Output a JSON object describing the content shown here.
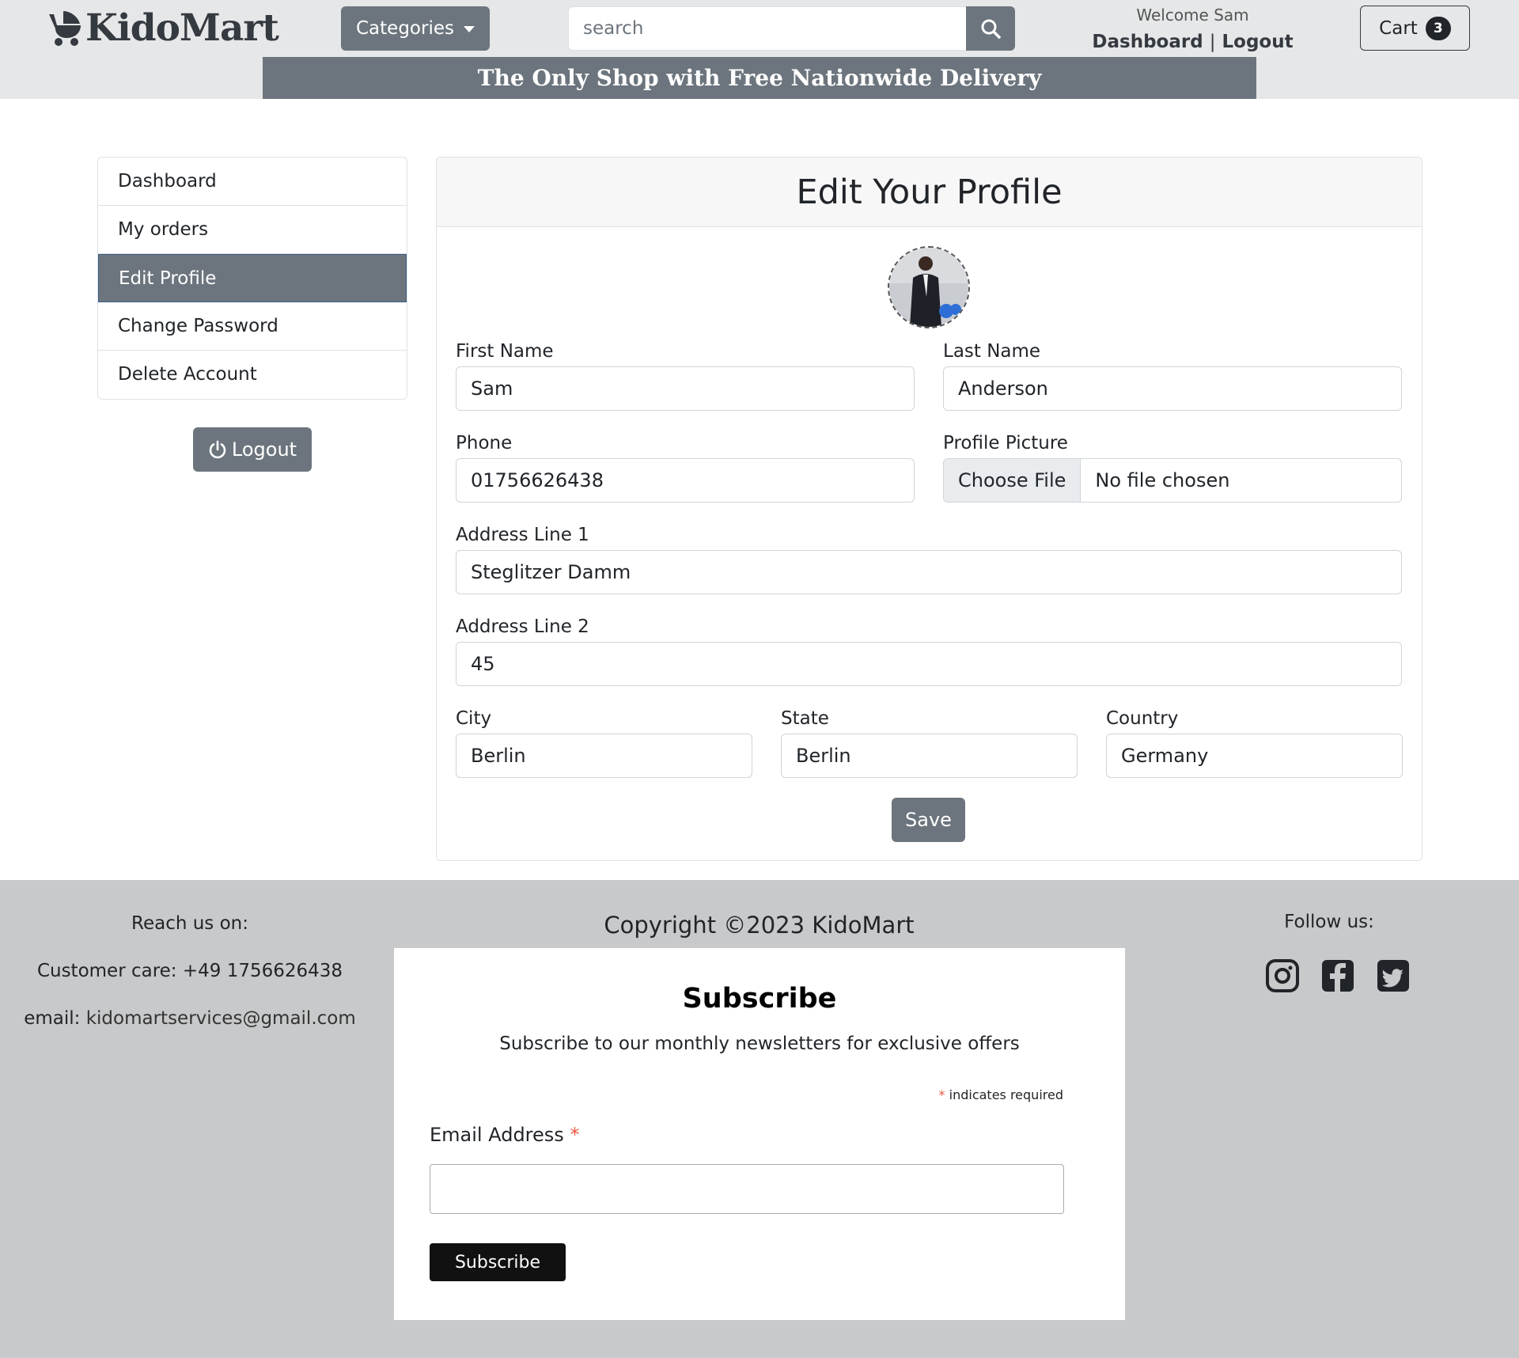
{
  "header": {
    "logo_text": "KidoMart",
    "categories_label": "Categories",
    "search_placeholder": "search",
    "welcome_text": "Welcome Sam",
    "dashboard_link": "Dashboard",
    "separator": "|",
    "logout_link": "Logout",
    "cart_label": "Cart",
    "cart_count": "3",
    "banner": "The Only Shop with Free Nationwide Delivery"
  },
  "sidebar": {
    "items": [
      {
        "label": "Dashboard"
      },
      {
        "label": "My orders"
      },
      {
        "label": "Edit Profile",
        "active": true
      },
      {
        "label": "Change Password"
      },
      {
        "label": "Delete Account"
      }
    ],
    "logout_label": "Logout"
  },
  "profile": {
    "title": "Edit Your Profile",
    "first_name_label": "First Name",
    "first_name": "Sam",
    "last_name_label": "Last Name",
    "last_name": "Anderson",
    "phone_label": "Phone",
    "phone": "01756626438",
    "picture_label": "Profile Picture",
    "choose_file": "Choose File",
    "no_file": "No file chosen",
    "address1_label": "Address Line 1",
    "address1": "Steglitzer Damm",
    "address2_label": "Address Line 2",
    "address2": "45",
    "city_label": "City",
    "city": "Berlin",
    "state_label": "State",
    "state": "Berlin",
    "country_label": "Country",
    "country": "Germany",
    "save_label": "Save"
  },
  "footer": {
    "reach_title": "Reach us on:",
    "customer_care": "Customer care: +49 1756626438",
    "email_prefix": "email: ",
    "email": "kidomartservices@gmail.com",
    "copyright": "Copyright ©2023 KidoMart",
    "follow_title": "Follow us:",
    "social_icons": [
      "instagram-icon",
      "facebook-icon",
      "twitter-icon"
    ],
    "subscribe": {
      "title": "Subscribe",
      "description": "Subscribe to our monthly newsletters for exclusive offers",
      "required_star": "*",
      "required_note": "indicates required",
      "email_label": "Email Address",
      "button_label": "Subscribe"
    }
  },
  "colors": {
    "header_bg": "#e6e7e8",
    "secondary": "#6c757d",
    "footer_bg": "#c8c9ca",
    "required_star": "#e85c41"
  }
}
